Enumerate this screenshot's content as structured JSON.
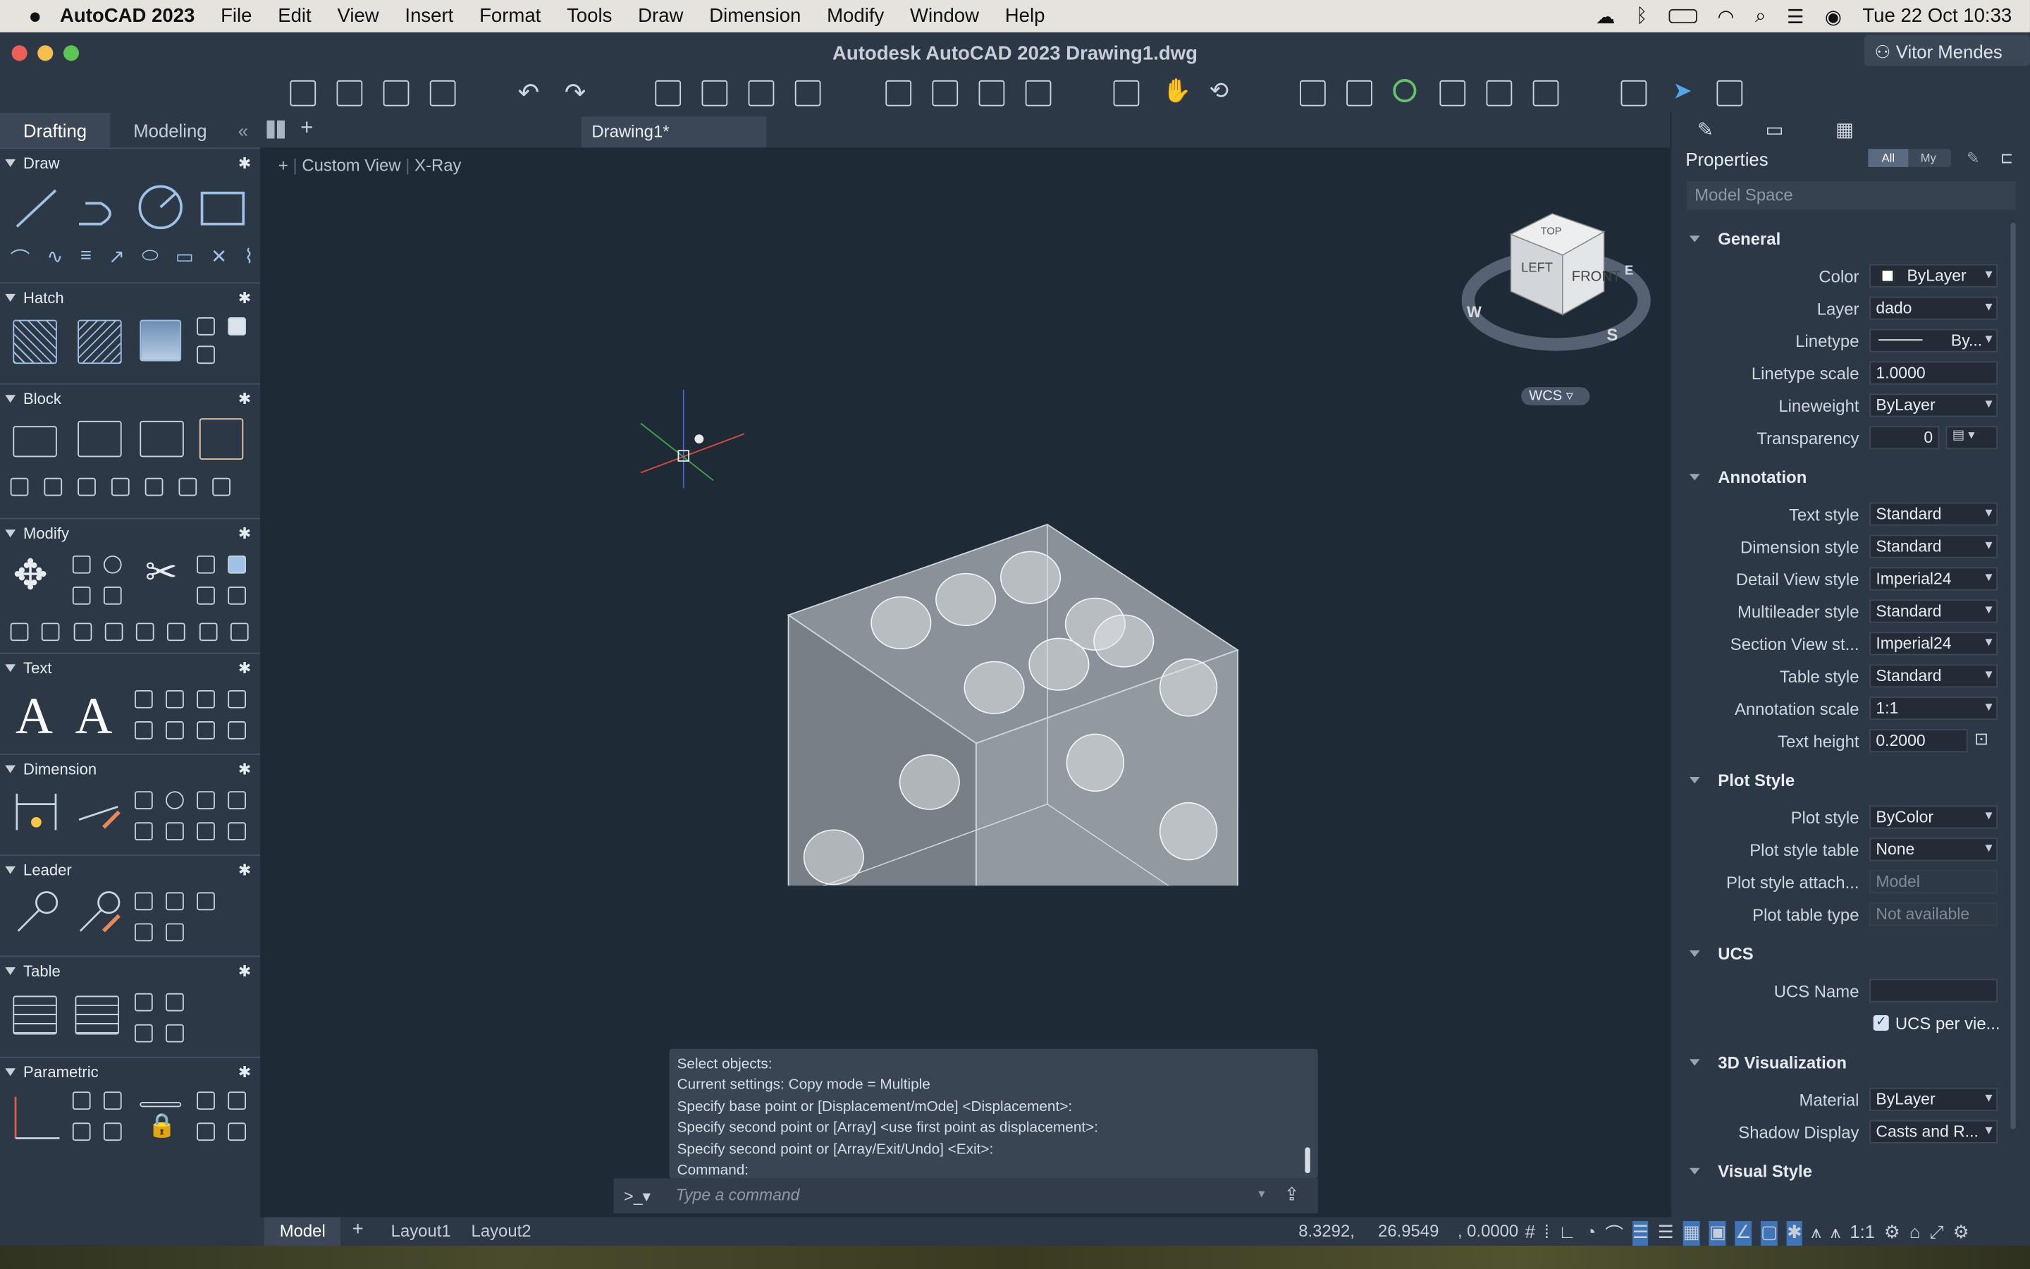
{
  "menubar": {
    "app": "AutoCAD 2023",
    "items": [
      "File",
      "Edit",
      "View",
      "Insert",
      "Format",
      "Tools",
      "Draw",
      "Dimension",
      "Modify",
      "Window",
      "Help"
    ],
    "datetime": "Tue 22 Oct  10:33"
  },
  "window": {
    "title": "Autodesk AutoCAD 2023    Drawing1.dwg",
    "user": "Vitor Mendes"
  },
  "left_tabs": {
    "drafting": "Drafting",
    "modeling": "Modeling"
  },
  "sections": {
    "draw": "Draw",
    "hatch": "Hatch",
    "block": "Block",
    "modify": "Modify",
    "text": "Text",
    "dimension": "Dimension",
    "leader": "Leader",
    "table": "Table",
    "parametric": "Parametric"
  },
  "doc_tab": "Drawing1*",
  "viewport": {
    "view": "Custom View",
    "style": "X-Ray",
    "ucs": "WCS",
    "cube": {
      "top": "TOP",
      "front": "FRONT",
      "left": "LEFT",
      "n": "W",
      "s": "S",
      "e": "E"
    }
  },
  "command_history": [
    "Select objects:",
    "Current settings:  Copy mode = Multiple",
    "Specify base point or [Displacement/mOde] <Displacement>:",
    "Specify second point or [Array] <use first point as displacement>:",
    "Specify second point or [Array/Exit/Undo] <Exit>:",
    "Command:"
  ],
  "command_prompt": ">_▾",
  "command_placeholder": "Type a command",
  "layout_tabs": {
    "model": "Model",
    "layout1": "Layout1",
    "layout2": "Layout2"
  },
  "coordinates": "8.3292,     26.9549    , 0.0000",
  "zoom": "1:1",
  "properties": {
    "title": "Properties",
    "all": "All",
    "my": "My",
    "space": "Model Space",
    "groups": {
      "general": "General",
      "annotation": "Annotation",
      "plot": "Plot Style",
      "ucs": "UCS",
      "viz": "3D Visualization",
      "visual": "Visual Style"
    },
    "rows": {
      "color": {
        "label": "Color",
        "value": "ByLayer"
      },
      "layer": {
        "label": "Layer",
        "value": "dado"
      },
      "linetype": {
        "label": "Linetype",
        "value": "By..."
      },
      "ltscale": {
        "label": "Linetype scale",
        "value": "1.0000"
      },
      "lineweight": {
        "label": "Lineweight",
        "value": "ByLayer"
      },
      "transparency": {
        "label": "Transparency",
        "value": "0"
      },
      "textstyle": {
        "label": "Text style",
        "value": "Standard"
      },
      "dimstyle": {
        "label": "Dimension style",
        "value": "Standard"
      },
      "detailstyle": {
        "label": "Detail View style",
        "value": "Imperial24"
      },
      "mleaderstyle": {
        "label": "Multileader style",
        "value": "Standard"
      },
      "sectionstyle": {
        "label": "Section View st...",
        "value": "Imperial24"
      },
      "tablestyle": {
        "label": "Table style",
        "value": "Standard"
      },
      "annoscale": {
        "label": "Annotation scale",
        "value": "1:1"
      },
      "textheight": {
        "label": "Text height",
        "value": "0.2000"
      },
      "plotstyle": {
        "label": "Plot style",
        "value": "ByColor"
      },
      "plottable": {
        "label": "Plot style table",
        "value": "None"
      },
      "plotattach": {
        "label": "Plot style attach...",
        "value": "Model"
      },
      "plottype": {
        "label": "Plot table type",
        "value": "Not available"
      },
      "ucsname": {
        "label": "UCS Name",
        "value": ""
      },
      "ucsper": {
        "label": "UCS per vie..."
      },
      "material": {
        "label": "Material",
        "value": "ByLayer"
      },
      "shadow": {
        "label": "Shadow Display",
        "value": "Casts and R..."
      }
    }
  }
}
